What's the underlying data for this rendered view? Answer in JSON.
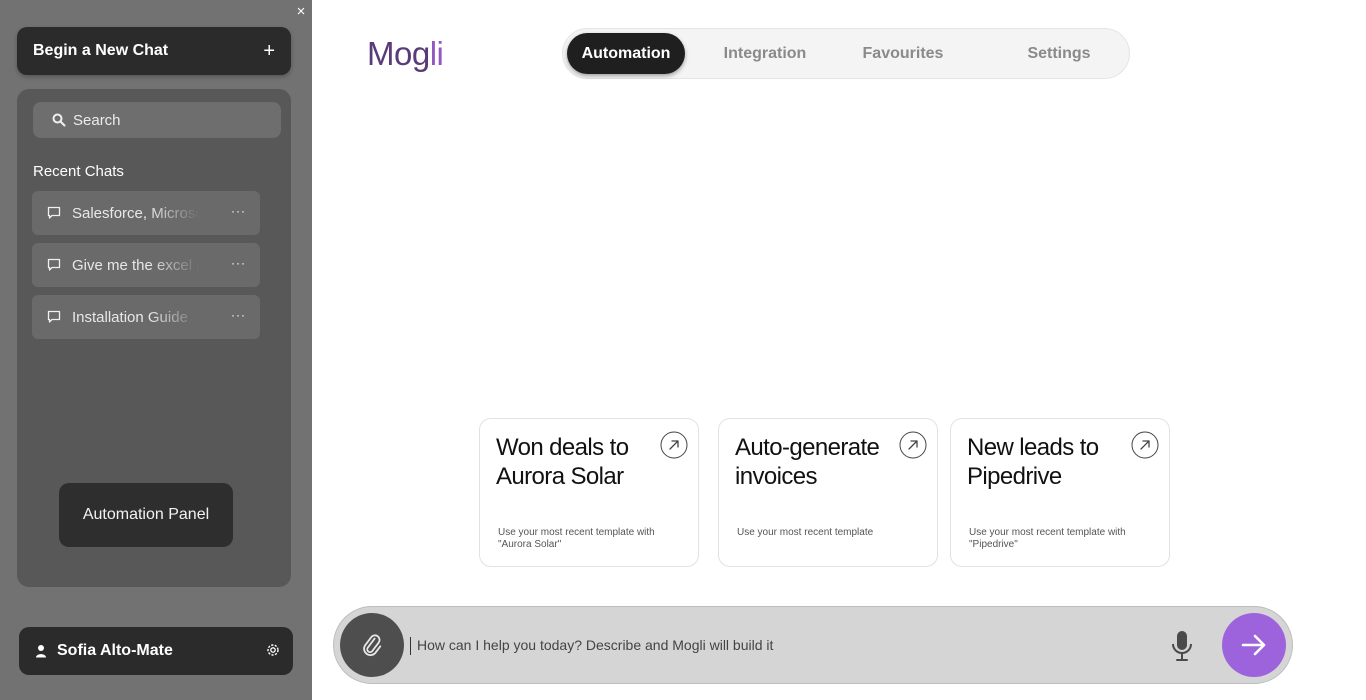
{
  "sidebar": {
    "close_label": "×",
    "new_chat": {
      "label": "Begin a New Chat",
      "plus": "+"
    },
    "search": {
      "placeholder": "Search"
    },
    "recent_title": "Recent Chats",
    "recent_chats": [
      {
        "label": "Salesforce, Microsoft Dynamics",
        "menu": "···"
      },
      {
        "label": "Give me the excel report",
        "menu": "···"
      },
      {
        "label": "Installation Guide",
        "menu": "···"
      }
    ],
    "automation_panel": "Automation Panel",
    "user": {
      "name": "Sofia Alto-Mate"
    }
  },
  "header": {
    "logo_main": "Mog",
    "logo_accent": "li",
    "tabs": [
      {
        "label": "Automation",
        "active": true
      },
      {
        "label": "Integration",
        "active": false
      },
      {
        "label": "Favourites",
        "active": false
      },
      {
        "label": "Settings",
        "active": false
      }
    ]
  },
  "cards": [
    {
      "title": "Won deals to Aurora Solar",
      "desc": "Use your most recent template with \"Aurora Solar\""
    },
    {
      "title": "Auto-generate invoices",
      "desc": "Use your most recent template"
    },
    {
      "title": "New leads to Pipedrive",
      "desc": "Use your most recent template with \"Pipedrive\""
    }
  ],
  "composer": {
    "placeholder": "How can I help you today? Describe and Mogli will build it"
  },
  "colors": {
    "sidebar_bg": "#727272",
    "accent": "#9d63dd",
    "logo": "#5a3b7a"
  },
  "icons": {
    "close": "close-icon",
    "new_chat": "plus-icon",
    "search": "search-icon",
    "chat": "chat-bubble-icon",
    "menu": "more-dots-icon",
    "user": "person-icon",
    "settings": "gear-icon",
    "card": "arrow-up-right-icon",
    "attach": "paperclip-icon",
    "mic": "microphone-icon",
    "send": "arrow-right-icon"
  }
}
